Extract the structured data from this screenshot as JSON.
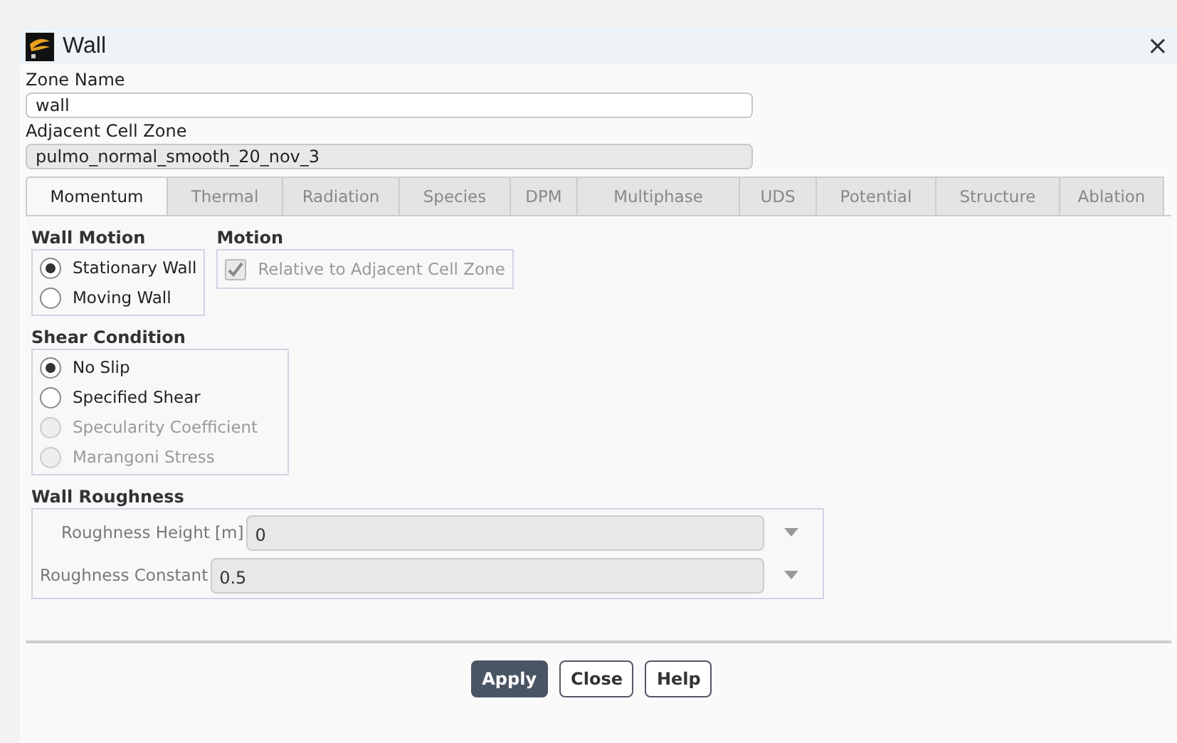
{
  "window": {
    "title": "Wall",
    "close": "×"
  },
  "zone_name": {
    "label": "Zone Name",
    "value": "wall"
  },
  "adjacent_cell_zone": {
    "label": "Adjacent Cell Zone",
    "value": "pulmo_normal_smooth_20_nov_3"
  },
  "tabs": [
    {
      "label": "Momentum",
      "selected": true
    },
    {
      "label": "Thermal",
      "selected": false
    },
    {
      "label": "Radiation",
      "selected": false
    },
    {
      "label": "Species",
      "selected": false
    },
    {
      "label": "DPM",
      "selected": false
    },
    {
      "label": "Multiphase",
      "selected": false
    },
    {
      "label": "UDS",
      "selected": false
    },
    {
      "label": "Potential",
      "selected": false
    },
    {
      "label": "Structure",
      "selected": false
    },
    {
      "label": "Ablation",
      "selected": false
    }
  ],
  "wall_motion": {
    "title": "Wall Motion",
    "options": [
      {
        "label": "Stationary Wall",
        "selected": true,
        "disabled": false
      },
      {
        "label": "Moving Wall",
        "selected": false,
        "disabled": false
      }
    ]
  },
  "motion": {
    "title": "Motion",
    "checkbox": {
      "label": "Relative to Adjacent Cell Zone",
      "checked": true,
      "disabled": true
    }
  },
  "shear_condition": {
    "title": "Shear Condition",
    "options": [
      {
        "label": "No Slip",
        "selected": true,
        "disabled": false
      },
      {
        "label": "Specified Shear",
        "selected": false,
        "disabled": false
      },
      {
        "label": "Specularity Coefficient",
        "selected": false,
        "disabled": true
      },
      {
        "label": "Marangoni Stress",
        "selected": false,
        "disabled": true
      }
    ]
  },
  "wall_roughness": {
    "title": "Wall Roughness",
    "fields": [
      {
        "label": "Roughness Height [m]",
        "value": "0"
      },
      {
        "label": "Roughness Constant",
        "value": "0.5"
      }
    ]
  },
  "buttons": [
    {
      "label": "Apply",
      "primary": true
    },
    {
      "label": "Close",
      "primary": false
    },
    {
      "label": "Help",
      "primary": false
    }
  ]
}
